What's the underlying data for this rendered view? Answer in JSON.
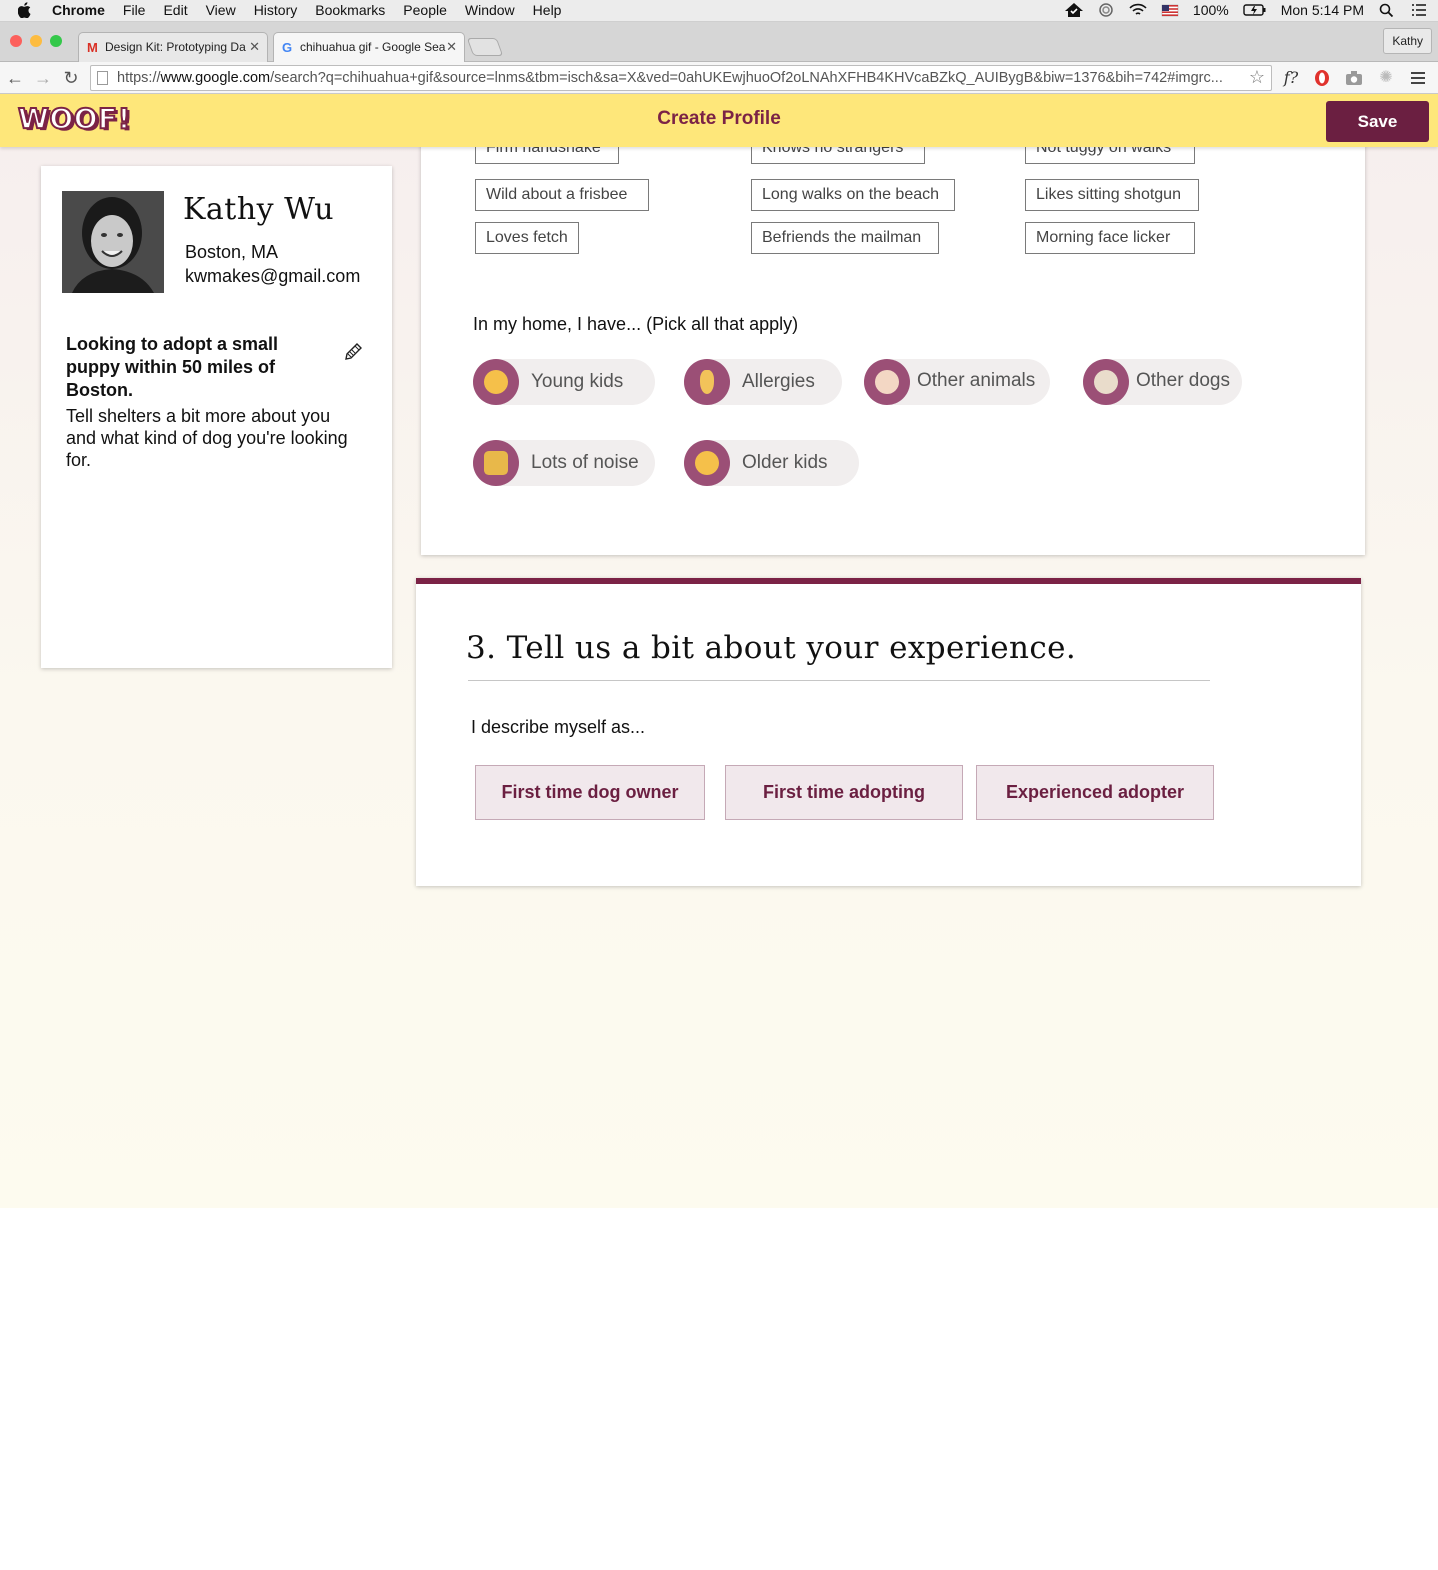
{
  "menubar": {
    "app": "Chrome",
    "items": [
      "File",
      "Edit",
      "View",
      "History",
      "Bookmarks",
      "People",
      "Window",
      "Help"
    ],
    "battery": "100%",
    "clock": "Mon 5:14 PM"
  },
  "tabs": [
    {
      "title": "Design Kit: Prototyping Da",
      "favicon": "gmail-icon"
    },
    {
      "title": "chihuahua gif - Google Sea",
      "favicon": "google-icon"
    }
  ],
  "profile_button": "Kathy",
  "omnibox": {
    "prefix": "https://",
    "host": "www.google.com",
    "rest": "/search?q=chihuahua+gif&source=lnms&tbm=isch&sa=X&ved=0ahUKEwjhuoOf2oLNAhXFHB4KHVcaBZkQ_AUIBygB&biw=1376&bih=742#imgrc..."
  },
  "extensions": {
    "f_label": "f?"
  },
  "app": {
    "logo": "WOOF!",
    "title": "Create Profile",
    "save": "Save"
  },
  "profile": {
    "name": "Kathy Wu",
    "location": "Boston, MA",
    "email": "kwmakes@gmail.com",
    "goal": "Looking to adopt a small puppy within 50 miles of Boston.",
    "description": "Tell shelters a bit more about you and what kind of dog you're looking for."
  },
  "traits": [
    [
      "Firm handshake",
      "Knows no strangers",
      "Not tuggy on walks"
    ],
    [
      "Wild about a frisbee",
      "Long walks on the beach",
      "Likes sitting shotgun"
    ],
    [
      "Loves fetch",
      "Befriends the mailman",
      "Morning face licker"
    ]
  ],
  "home": {
    "prompt": "In my home, I have... (Pick all that apply)",
    "options": [
      {
        "label": "Young kids",
        "icon": "baby-icon"
      },
      {
        "label": "Allergies",
        "icon": "nose-icon"
      },
      {
        "label": "Other animals",
        "icon": "hamster-icon"
      },
      {
        "label": "Other dogs",
        "icon": "dog-face-icon"
      },
      {
        "label": "Lots of noise",
        "icon": "megaphone-icon"
      },
      {
        "label": "Older kids",
        "icon": "child-icon"
      }
    ]
  },
  "experience": {
    "title": "3. Tell us a bit about your experience.",
    "prompt": "I describe myself as...",
    "options": [
      "First time dog owner",
      "First time adopting",
      "Experienced adopter"
    ]
  },
  "colors": {
    "brand": "#7b2346",
    "header_bg": "#fee77a",
    "save_bg": "#6b1f41",
    "chip_icon_bg": "#9b4f76"
  }
}
